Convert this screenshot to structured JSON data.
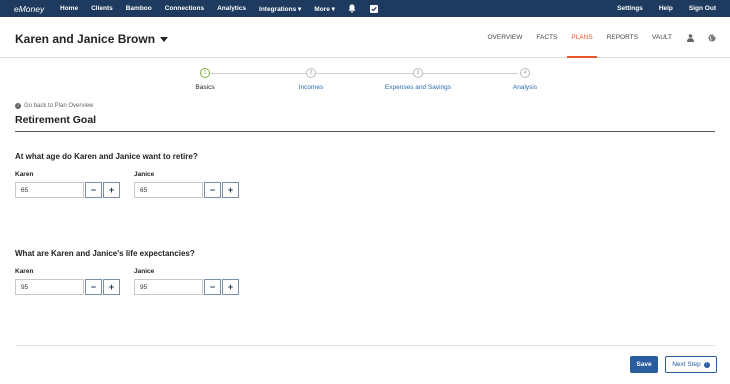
{
  "topnav": {
    "logo": "eMoney",
    "items": [
      "Home",
      "Clients",
      "Bamboo",
      "Connections",
      "Analytics",
      "Integrations ▾",
      "More ▾"
    ],
    "icons": [
      "bell-icon",
      "checkbox-icon"
    ],
    "right_items": [
      "Settings",
      "Help",
      "Sign Out"
    ]
  },
  "client": {
    "name": "Karen and Janice Brown",
    "tabs": [
      "OVERVIEW",
      "FACTS",
      "PLANS",
      "REPORTS",
      "VAULT"
    ],
    "active_tab": "PLANS",
    "icons": [
      "person-icon",
      "globe-icon"
    ]
  },
  "stepper": {
    "steps": [
      {
        "num": "1",
        "label": "Basics",
        "active": true
      },
      {
        "num": "2",
        "label": "Incomes",
        "active": false
      },
      {
        "num": "3",
        "label": "Expenses and Savings",
        "active": false
      },
      {
        "num": "4",
        "label": "Analysis",
        "active": false
      }
    ]
  },
  "page": {
    "back_link": "Go back to Plan Overview",
    "title": "Retirement Goal"
  },
  "retire_age": {
    "question": "At what age do Karen and Janice want to retire?",
    "karen_label": "Karen",
    "karen_value": "65",
    "janice_label": "Janice",
    "janice_value": "65"
  },
  "life_expectancy": {
    "question": "What are Karen and Janice's life expectancies?",
    "karen_label": "Karen",
    "karen_value": "95",
    "janice_label": "Janice",
    "janice_value": "95"
  },
  "footer": {
    "save": "Save",
    "next": "Next Step"
  },
  "controls": {
    "minus": "−",
    "plus": "+"
  },
  "colors": {
    "nav_bg": "#1e3a5f",
    "accent_orange": "#e8572a",
    "primary_blue": "#2a5d9f",
    "step_active_green": "#7cb342"
  }
}
